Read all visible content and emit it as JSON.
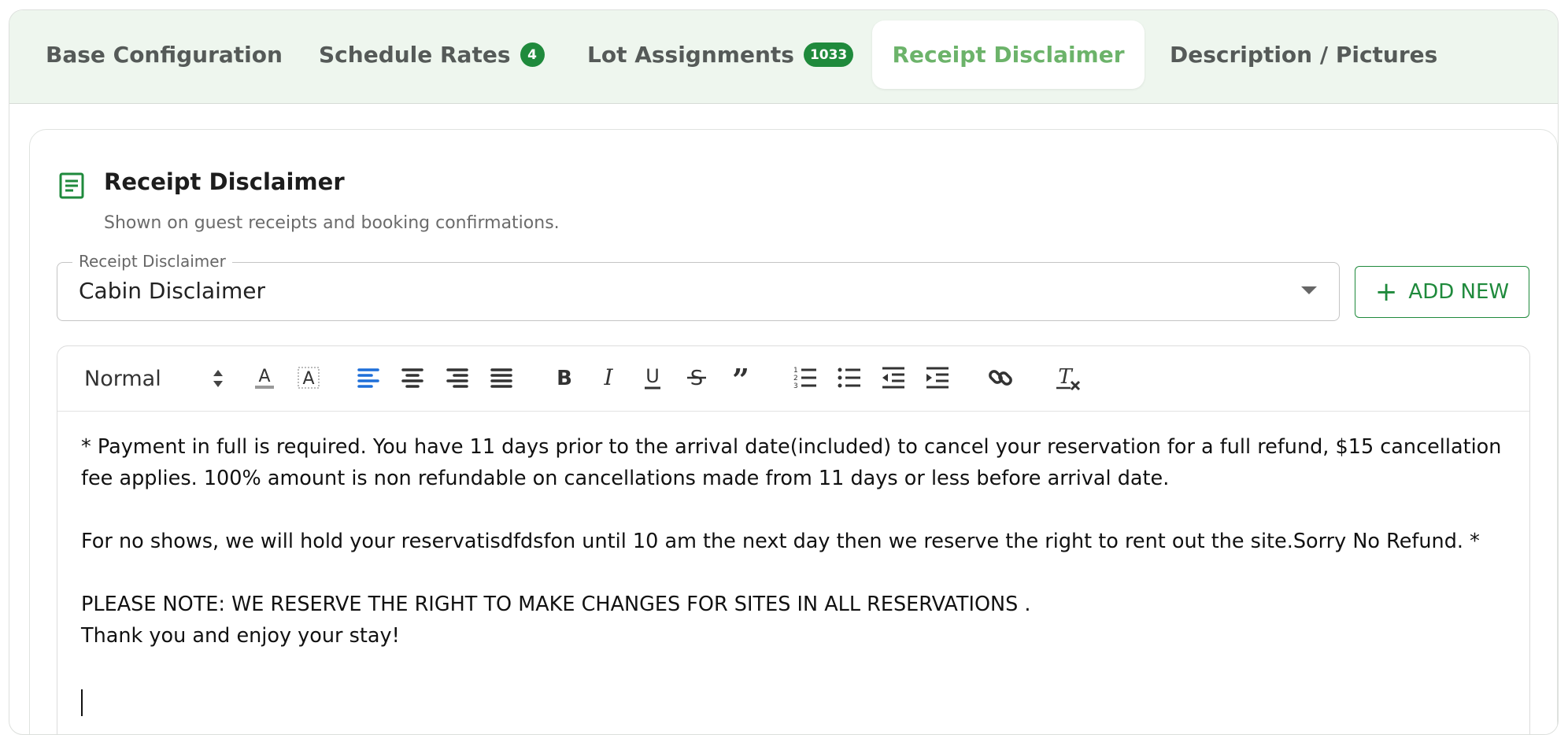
{
  "tabs": [
    {
      "label": "Base Configuration",
      "badge": null
    },
    {
      "label": "Schedule Rates",
      "badge": "4"
    },
    {
      "label": "Lot Assignments",
      "badge": "1033"
    },
    {
      "label": "Receipt Disclaimer",
      "badge": null,
      "active": true
    },
    {
      "label": "Description / Pictures",
      "badge": null
    }
  ],
  "card": {
    "icon": "document-icon",
    "title": "Receipt Disclaimer",
    "subtitle": "Shown on guest receipts and booking confirmations."
  },
  "disclaimer_select": {
    "label": "Receipt Disclaimer",
    "value": "Cabin Disclaimer"
  },
  "add_new_label": "ADD NEW",
  "editor": {
    "heading_format": "Normal",
    "toolbar_icons": [
      "text-color-icon",
      "highlight-icon",
      "align-left-icon",
      "align-center-icon",
      "align-right-icon",
      "align-justify-icon",
      "bold-icon",
      "italic-icon",
      "underline-icon",
      "strikethrough-icon",
      "blockquote-icon",
      "ordered-list-icon",
      "bullet-list-icon",
      "outdent-icon",
      "indent-icon",
      "link-icon",
      "clear-format-icon"
    ],
    "paragraphs": [
      "* Payment in full is required. You have 11 days prior to the arrival date(included) to cancel your reservation for a full refund, $15 cancellation fee applies. 100% amount is non refundable on cancellations made from 11 days or less before arrival date.",
      "For no shows, we will hold your reservatisdfdsfon until 10 am the next day then we reserve the right to rent out the site.Sorry No Refund. *",
      "PLEASE NOTE: WE RESERVE THE RIGHT TO MAKE CHANGES FOR SITES IN ALL RESERVATIONS .",
      "Thank you and enjoy your stay!"
    ]
  },
  "colors": {
    "accent_green": "#1f8a3c",
    "active_tab_text": "#6cb36a",
    "tabbar_bg": "#eef6ee",
    "active_align_blue": "#1e6fd9"
  }
}
